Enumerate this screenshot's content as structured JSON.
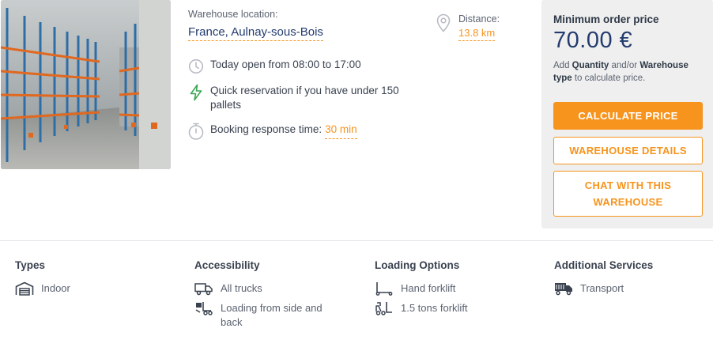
{
  "location": {
    "label": "Warehouse location:",
    "value": "France, Aulnay-sous-Bois"
  },
  "distance": {
    "label": "Distance:",
    "value": "13.8 km"
  },
  "info": {
    "open_hours": "Today open from 08:00 to 17:00",
    "quick_reservation": "Quick reservation if you have under 150 pallets",
    "booking_label": "Booking response time:",
    "booking_value": "30 min"
  },
  "pricing": {
    "label": "Minimum order price",
    "value": "70.00 €",
    "hint_prefix": "Add ",
    "hint_quantity": "Quantity",
    "hint_mid": " and/or ",
    "hint_type": "Warehouse type",
    "hint_suffix": " to calculate price.",
    "calculate_button": "CALCULATE PRICE",
    "details_button": "WAREHOUSE DETAILS",
    "chat_button": "CHAT WITH THIS WAREHOUSE"
  },
  "features": {
    "types": {
      "title": "Types",
      "items": [
        {
          "label": "Indoor",
          "icon": "warehouse-icon"
        }
      ]
    },
    "accessibility": {
      "title": "Accessibility",
      "items": [
        {
          "label": "All trucks",
          "icon": "truck-icon"
        },
        {
          "label": "Loading from side and back",
          "icon": "loading-icon"
        }
      ]
    },
    "loading": {
      "title": "Loading Options",
      "items": [
        {
          "label": "Hand forklift",
          "icon": "hand-forklift-icon"
        },
        {
          "label": "1.5 tons forklift",
          "icon": "forklift-icon"
        }
      ]
    },
    "additional": {
      "title": "Additional Services",
      "items": [
        {
          "label": "Transport",
          "icon": "transport-truck-icon"
        }
      ]
    }
  },
  "colors": {
    "accent": "#f7941d",
    "navy": "#233b6e",
    "green": "#3aa655",
    "panel": "#efefef"
  }
}
